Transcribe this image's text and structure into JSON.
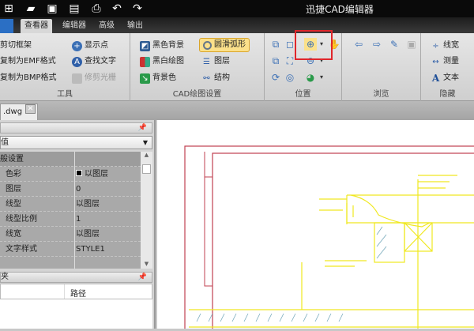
{
  "app": {
    "title": "迅捷CAD编辑器"
  },
  "quick_access": [
    "new-icon",
    "open-icon",
    "save-icon",
    "save-as-icon",
    "print-icon",
    "undo-icon",
    "redo-icon"
  ],
  "tabs": [
    {
      "label": "查看器",
      "active": true
    },
    {
      "label": "编辑器"
    },
    {
      "label": "高级"
    },
    {
      "label": "输出"
    }
  ],
  "ribbon": {
    "tools": {
      "label": "工具",
      "items": [
        "剪切框架",
        "复制为EMF格式",
        "复制为BMP格式",
        "显示点",
        "查找文字",
        "修剪光栅"
      ]
    },
    "cad": {
      "label": "CAD绘图设置",
      "items": [
        "黑色背景",
        "黑白绘图",
        "背景色",
        "圆滑弧形",
        "图层",
        "结构"
      ]
    },
    "position": {
      "label": "位置"
    },
    "browse": {
      "label": "浏览"
    },
    "hide": {
      "label": "隐藏",
      "items": [
        "线宽",
        "测量",
        "文本"
      ]
    }
  },
  "document": {
    "tab": ".dwg"
  },
  "properties": {
    "combo": "值",
    "section": "般设置",
    "rows": [
      {
        "name": "色彩",
        "value": "以图层"
      },
      {
        "name": "图层",
        "value": "0"
      },
      {
        "name": "线型",
        "value": "以图层"
      },
      {
        "name": "线型比例",
        "value": "1"
      },
      {
        "name": "线宽",
        "value": "以图层"
      },
      {
        "name": "文字样式",
        "value": "STYLE1"
      }
    ]
  },
  "files": {
    "title": "夹",
    "column": "路径"
  },
  "colors": {
    "accent": "#e0262b",
    "cad_border": "#c04050",
    "cad_line": "#f0e820"
  }
}
